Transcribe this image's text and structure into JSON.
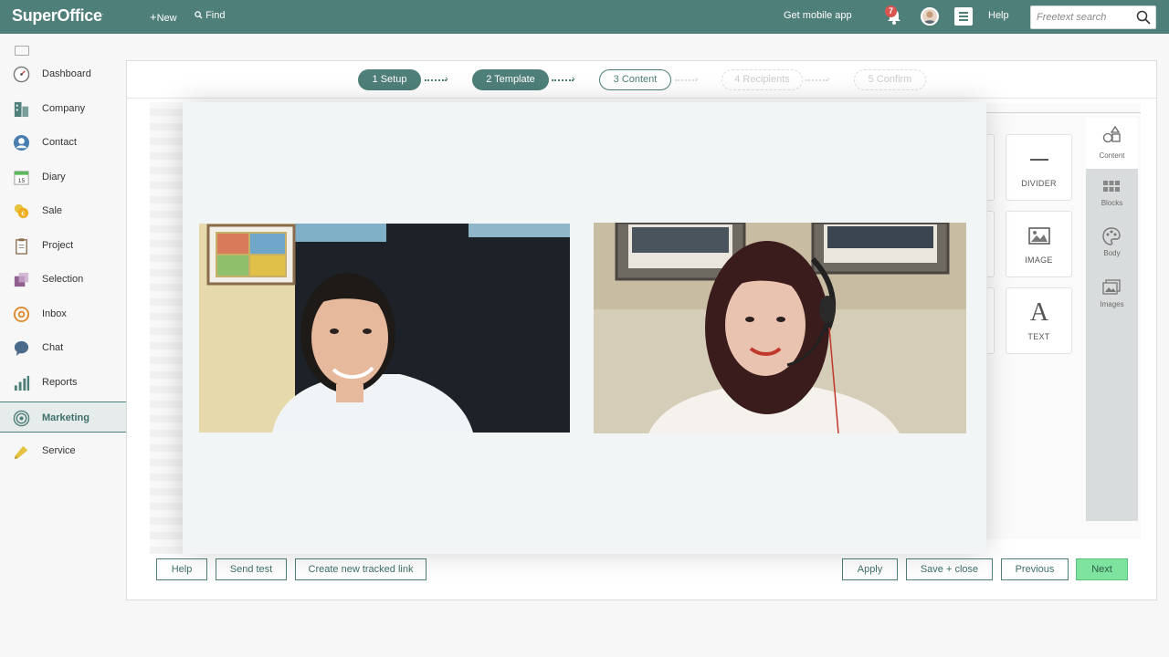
{
  "topbar": {
    "logo": "SuperOffice",
    "logo_mark": ".",
    "new_label": "New",
    "find_label": "Find",
    "mobile_label": "Get mobile app",
    "notification_count": "7",
    "help_label": "Help",
    "search_placeholder": "Freetext search",
    "bg_color": "#4f7f79"
  },
  "sidebar": {
    "items": [
      {
        "label": "Dashboard",
        "icon": "dashboard-icon"
      },
      {
        "label": "Company",
        "icon": "company-icon"
      },
      {
        "label": "Contact",
        "icon": "contact-icon"
      },
      {
        "label": "Diary",
        "icon": "diary-icon"
      },
      {
        "label": "Sale",
        "icon": "sale-icon"
      },
      {
        "label": "Project",
        "icon": "project-icon"
      },
      {
        "label": "Selection",
        "icon": "selection-icon"
      },
      {
        "label": "Inbox",
        "icon": "inbox-icon"
      },
      {
        "label": "Chat",
        "icon": "chat-icon"
      },
      {
        "label": "Reports",
        "icon": "reports-icon"
      },
      {
        "label": "Marketing",
        "icon": "marketing-icon",
        "active": true
      },
      {
        "label": "Service",
        "icon": "service-icon"
      }
    ],
    "diary_day": "15"
  },
  "wizard": {
    "steps": [
      {
        "label": "1 Setup",
        "state": "done"
      },
      {
        "label": "2 Template",
        "state": "done"
      },
      {
        "label": "3 Content",
        "state": "current"
      },
      {
        "label": "4 Recipients",
        "state": "future"
      },
      {
        "label": "5 Confirm",
        "state": "future"
      }
    ]
  },
  "content_tiles": [
    {
      "label": "DIVIDER",
      "icon": "divider-icon"
    },
    {
      "label": "IMAGE",
      "icon": "image-icon"
    },
    {
      "label": "TEXT",
      "icon": "text-icon"
    }
  ],
  "text_tile_glyph": "A",
  "right_tabs": [
    {
      "label": "Content",
      "icon": "shapes-icon",
      "active": true
    },
    {
      "label": "Blocks",
      "icon": "blocks-icon"
    },
    {
      "label": "Body",
      "icon": "palette-icon"
    },
    {
      "label": "Images",
      "icon": "images-icon"
    }
  ],
  "footer_buttons": {
    "help": "Help",
    "send_test": "Send test",
    "tracked_link": "Create new tracked link",
    "apply": "Apply",
    "save_close": "Save + close",
    "previous": "Previous",
    "next": "Next"
  },
  "colors": {
    "accent": "#4f7f79",
    "next_button": "#7de39e",
    "badge": "#d9534f"
  }
}
